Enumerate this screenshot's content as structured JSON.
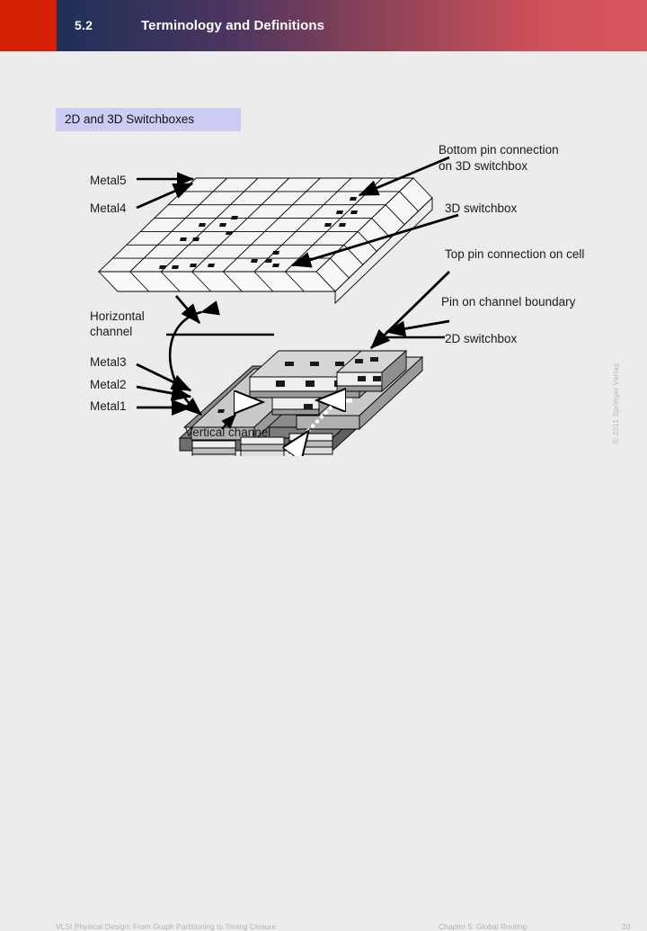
{
  "header": {
    "section_number": "5.2",
    "title": "Terminology and Definitions",
    "red_block_color": "#d62006",
    "gradient_start": "#1e3058",
    "gradient_end": "#d9555c"
  },
  "section_chip": {
    "label": "2D and 3D Switchboxes",
    "background": "#ccccf5"
  },
  "figure": {
    "labels": {
      "metal5": "Metal5",
      "metal4": "Metal4",
      "metal3": "Metal3",
      "metal2": "Metal2",
      "metal1": "Metal1",
      "horizontal_channel_line1": "Horizontal",
      "horizontal_channel_line2": "channel",
      "vertical_channel": "Vertical channel",
      "bottom_pin_line1": "Bottom pin connection",
      "bottom_pin_line2": "on 3D switchbox",
      "switchbox_3d": "3D switchbox",
      "top_pin": "Top pin connection on cell",
      "pin_on_boundary": "Pin on channel boundary",
      "switchbox_2d": "2D switchbox"
    }
  },
  "footer": {
    "book": "VLSI Physical Design: From Graph Partitioning to Timing Closure",
    "chapter": "Chapter 5: Global Routing",
    "page": "20",
    "copyright": "© 2011 Springer Verlag"
  }
}
